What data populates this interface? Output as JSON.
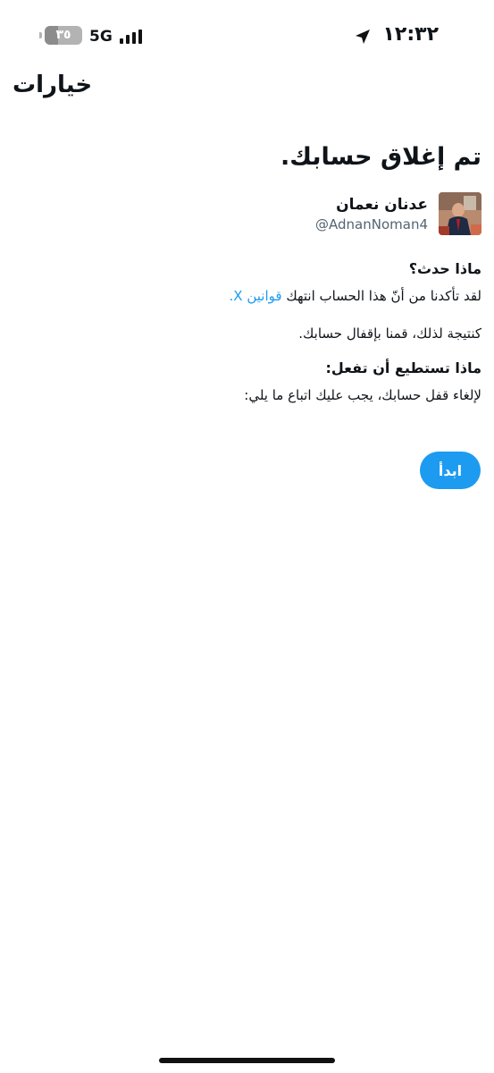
{
  "status_bar": {
    "time": "١٢:٣٢",
    "network": "5G",
    "battery_level": "٣٥",
    "battery_fraction": 0.35
  },
  "header": {
    "title": "خيارات"
  },
  "notice": {
    "title": "تم إغلاق حسابك.",
    "account": {
      "name": "عدنان نعمان",
      "handle": "@AdnanNoman4"
    },
    "what_happened": {
      "heading": "ماذا حدث؟",
      "text": "لقد تأكدنا من أنّ هذا الحساب انتهك",
      "link": "قوانين X",
      "link_suffix": ".",
      "result": "كنتيجة لذلك، قمنا بإقفال حسابك."
    },
    "what_to_do": {
      "heading": "ماذا تستطيع أن تفعل:",
      "text": "لإلغاء قفل حسابك، يجب عليك اتباع ما يلي:"
    },
    "start_button": "ابدأ"
  },
  "colors": {
    "accent": "#1d9bf0",
    "secondary_text": "#536471"
  }
}
